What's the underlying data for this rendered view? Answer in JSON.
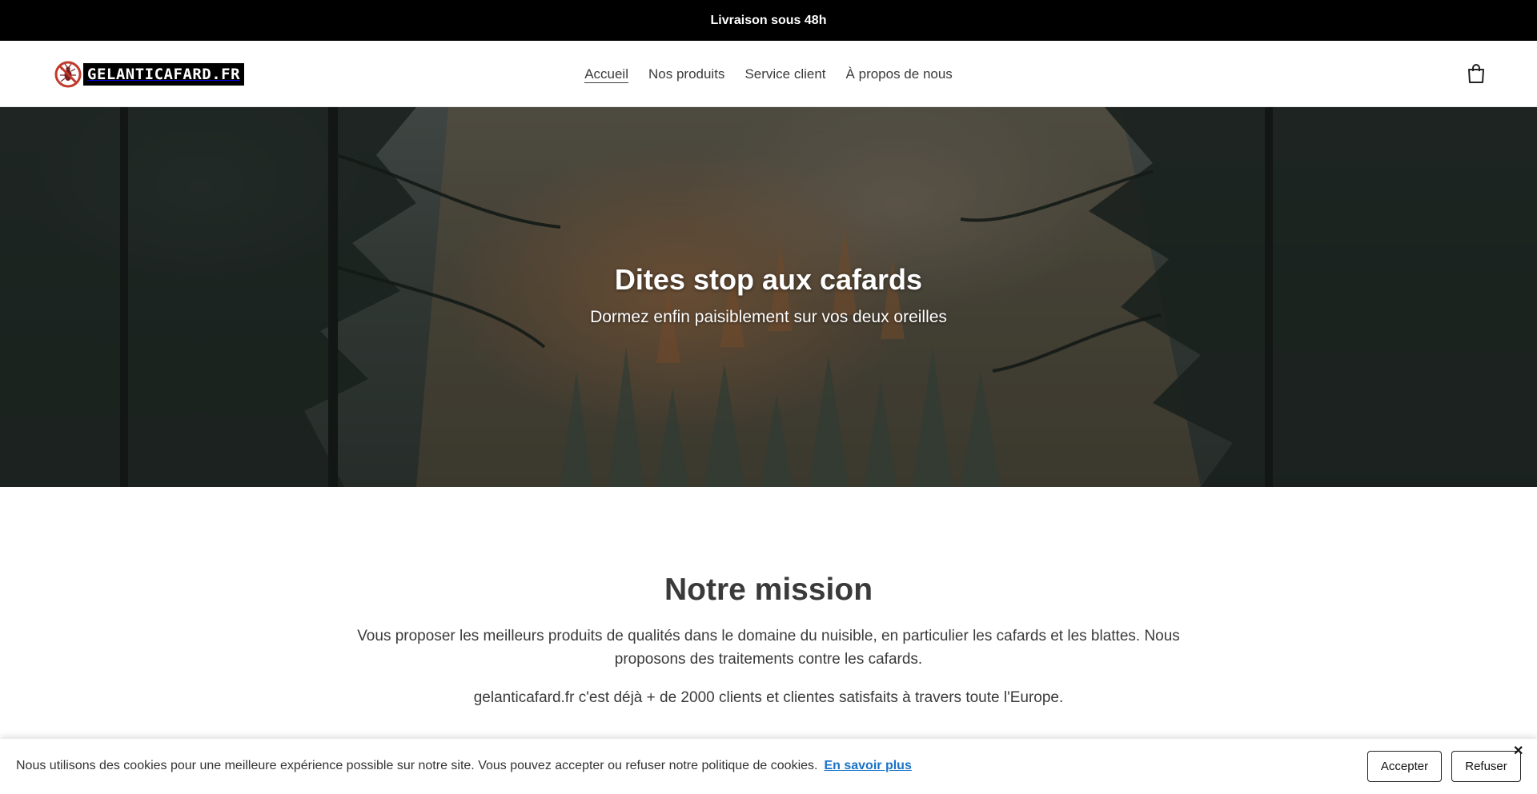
{
  "announcement": {
    "text": "Livraison sous 48h"
  },
  "header": {
    "logo_text": "GELANTICAFARD.FR",
    "nav": [
      {
        "label": "Accueil",
        "active": true
      },
      {
        "label": "Nos produits",
        "active": false
      },
      {
        "label": "Service client",
        "active": false
      },
      {
        "label": "À propos de nous",
        "active": false
      }
    ],
    "cart_icon": "shopping-bag-icon"
  },
  "hero": {
    "title": "Dites stop aux cafards",
    "subtitle": "Dormez enfin paisiblement sur vos deux oreilles"
  },
  "mission": {
    "title": "Notre mission",
    "paragraph1": "Vous proposer les meilleurs produits de qualités dans le domaine du nuisible, en particulier les cafards et les blattes. Nous proposons des traitements contre les cafards.",
    "paragraph2": "gelanticafard.fr c'est déjà + de 2000 clients et clientes satisfaits à travers toute l'Europe."
  },
  "cookie_banner": {
    "text": "Nous utilisons des cookies pour une meilleure expérience possible sur notre site. Vous pouvez accepter ou refuser notre politique de cookies.",
    "link_label": "En savoir plus",
    "accept_label": "Accepter",
    "refuse_label": "Refuser",
    "close_label": "✕"
  },
  "colors": {
    "announcement_bg": "#000000",
    "text": "#3a3a3a",
    "link": "#1a73c8",
    "logo_red": "#c0392b"
  }
}
